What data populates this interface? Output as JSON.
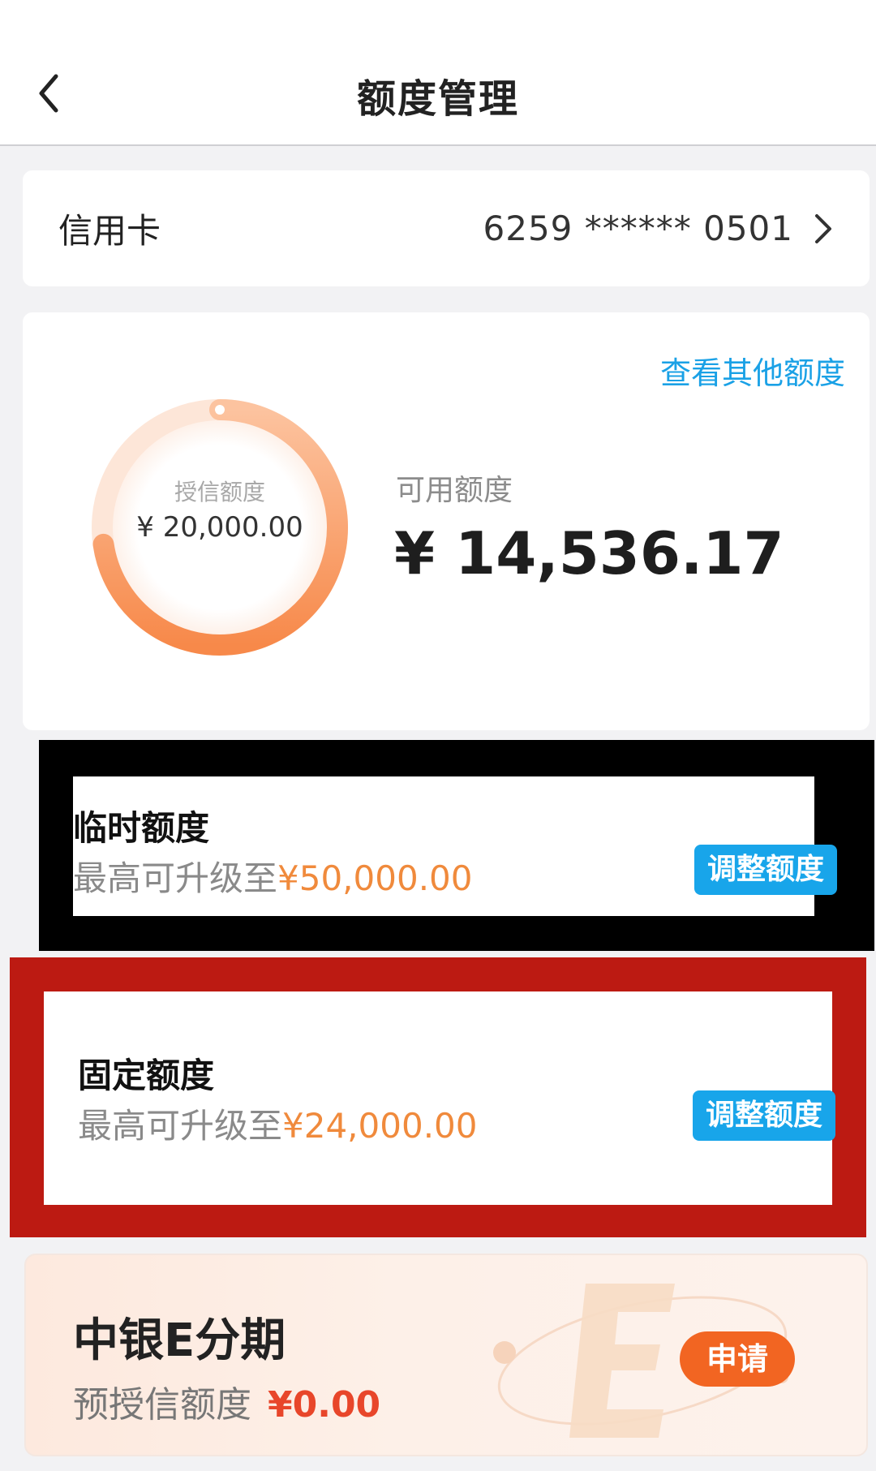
{
  "header": {
    "title": "额度管理"
  },
  "card": {
    "label": "信用卡",
    "number": "6259 ****** 0501"
  },
  "limit": {
    "other_link": "查看其他额度",
    "granted_label": "授信额度",
    "granted_value": "¥ 20,000.00",
    "available_label": "可用额度",
    "available_value": "¥ 14,536.17",
    "ring_fraction_available": 0.727
  },
  "temporary": {
    "title": "临时额度",
    "sub_prefix": "最高可升级至",
    "sub_amount": "¥50,000.00",
    "button": "调整额度"
  },
  "fixed": {
    "title": "固定额度",
    "sub_prefix": "最高可升级至",
    "sub_amount": "¥24,000.00",
    "button": "调整额度"
  },
  "installment": {
    "title": "中银E分期",
    "sub_prefix": "预授信额度",
    "sub_amount": "¥0.00",
    "button": "申请"
  },
  "colors": {
    "accent_blue": "#18a5ea",
    "accent_orange": "#f08a3c",
    "frame_black": "#000000",
    "frame_red": "#bc1a12",
    "apply_orange": "#f26522"
  }
}
